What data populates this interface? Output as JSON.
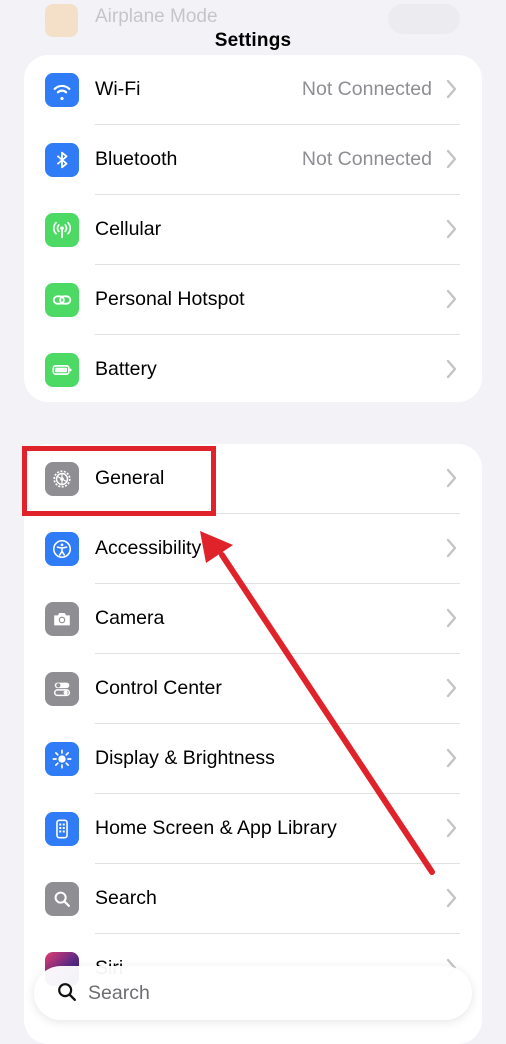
{
  "faded_row": {
    "label": "Airplane Mode"
  },
  "nav": {
    "title": "Settings"
  },
  "group1": [
    {
      "label": "Wi-Fi",
      "value": "Not Connected",
      "icon": "wifi-icon",
      "color": "#2f7cf6"
    },
    {
      "label": "Bluetooth",
      "value": "Not Connected",
      "icon": "bluetooth-icon",
      "color": "#2f7cf6"
    },
    {
      "label": "Cellular",
      "value": "",
      "icon": "cellular-icon",
      "color": "#4cd964"
    },
    {
      "label": "Personal Hotspot",
      "value": "",
      "icon": "hotspot-icon",
      "color": "#4cd964"
    },
    {
      "label": "Battery",
      "value": "",
      "icon": "battery-icon",
      "color": "#4cd964"
    }
  ],
  "group2": [
    {
      "label": "General",
      "icon": "gear-icon",
      "color": "#8e8e93"
    },
    {
      "label": "Accessibility",
      "icon": "accessibility-icon",
      "color": "#2f7cf6"
    },
    {
      "label": "Camera",
      "icon": "camera-icon",
      "color": "#8e8e93"
    },
    {
      "label": "Control Center",
      "icon": "control-center-icon",
      "color": "#8e8e93"
    },
    {
      "label": "Display & Brightness",
      "icon": "brightness-icon",
      "color": "#2f7cf6"
    },
    {
      "label": "Home Screen & App Library",
      "icon": "home-screen-icon",
      "color": "#2f7cf6"
    },
    {
      "label": "Search",
      "icon": "search-icon",
      "color": "#8e8e93"
    },
    {
      "label": "Siri",
      "icon": "siri-icon",
      "color": "#5b2a86"
    }
  ],
  "search": {
    "placeholder": "Search"
  },
  "annotation": {
    "highlight_color": "#e0222a"
  }
}
